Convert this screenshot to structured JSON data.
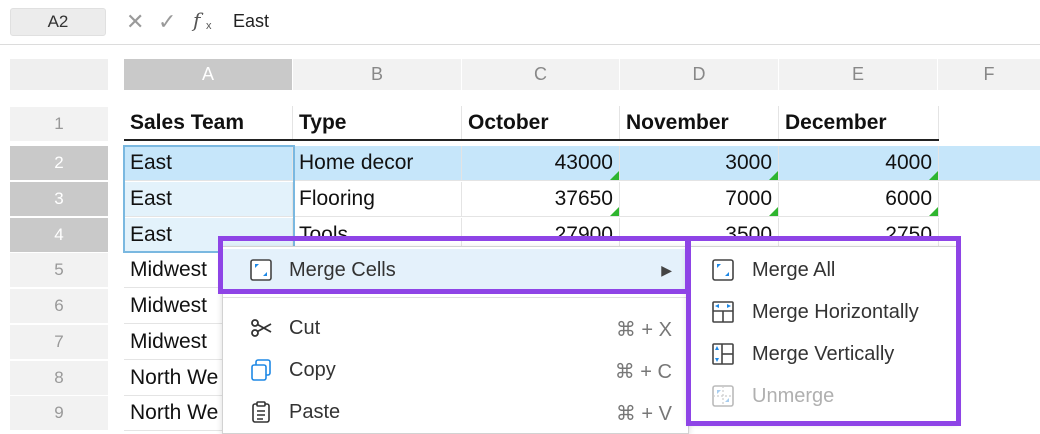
{
  "formula_bar": {
    "name_box": "A2",
    "cancel_icon": "✕",
    "confirm_icon": "✓",
    "fx_label": "f",
    "fx_sub": "x",
    "value": "East"
  },
  "columns": [
    "A",
    "B",
    "C",
    "D",
    "E",
    "F"
  ],
  "rows": [
    "1",
    "2",
    "3",
    "4",
    "5",
    "6",
    "7",
    "8",
    "9"
  ],
  "header_row": [
    "Sales Team",
    "Type",
    "October",
    "November",
    "December"
  ],
  "data_rows": [
    [
      "East",
      "Home decor",
      "43000",
      "3000",
      "4000"
    ],
    [
      "East",
      "Flooring",
      "37650",
      "7000",
      "6000"
    ],
    [
      "East",
      "Tools",
      "27900",
      "3500",
      "2750"
    ],
    [
      "Midwest"
    ],
    [
      "Midwest"
    ],
    [
      "Midwest"
    ],
    [
      "North We"
    ],
    [
      "North We"
    ]
  ],
  "context_menu": {
    "items": [
      {
        "label": "Merge Cells",
        "icon": "merge-cells-icon",
        "shortcut": "▶"
      },
      {
        "label": "Cut",
        "icon": "scissors-icon",
        "shortcut": "⌘ + X"
      },
      {
        "label": "Copy",
        "icon": "copy-icon",
        "shortcut": "⌘ + C"
      },
      {
        "label": "Paste",
        "icon": "clipboard-icon",
        "shortcut": "⌘ + V"
      }
    ]
  },
  "submenu": {
    "items": [
      {
        "label": "Merge All",
        "icon": "merge-all-icon",
        "enabled": true
      },
      {
        "label": "Merge Horizontally",
        "icon": "merge-horizontal-icon",
        "enabled": true
      },
      {
        "label": "Merge Vertically",
        "icon": "merge-vertical-icon",
        "enabled": true
      },
      {
        "label": "Unmerge",
        "icon": "unmerge-icon",
        "enabled": false
      }
    ]
  },
  "colors": {
    "highlight_outline": "#8e44e6",
    "selected_row": "#c6e6fa",
    "accent_blue": "#1e88e5"
  }
}
